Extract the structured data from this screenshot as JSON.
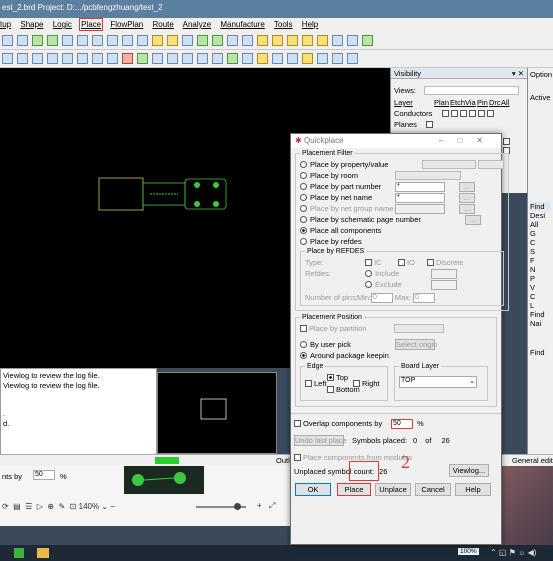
{
  "title": "est_2.brd  Project: D:.../pcbfengzhuang/test_2",
  "menu": [
    "tup",
    "Shape",
    "Logic",
    "Place",
    "FlowPlan",
    "Route",
    "Analyze",
    "Manufacture",
    "Tools",
    "Help"
  ],
  "visibility": {
    "title": "Visibility",
    "views_label": "Views:",
    "cols": [
      "Layer",
      "Plan",
      "Etch",
      "Via",
      "Pin",
      "Drc",
      "All"
    ],
    "rows": [
      "Conductors",
      "Planes"
    ]
  },
  "right_labels": [
    "Option",
    "Active",
    "Find",
    "Desi",
    "All",
    "G",
    "C",
    "S",
    "F",
    "N",
    "P",
    "V",
    "C",
    "L",
    "Find",
    "Nai",
    "Find"
  ],
  "log": [
    "Viewlog to review the log file.",
    "Viewlog to review the log file.",
    "",
    ".",
    "d."
  ],
  "status": {
    "outline": "Outlin",
    "edit": "General edit"
  },
  "strip": {
    "label": "nts by",
    "value": "50",
    "pct": "%",
    "zoom": "140%"
  },
  "dialog": {
    "title": "Quickplace",
    "filter_legend": "Placement Filter",
    "options": [
      "Place by property/value",
      "Place by room",
      "Place by part number",
      "Place by net name",
      "Place by net group name",
      "Place by schematic page number",
      "Place all components",
      "Place by refdes"
    ],
    "selected_option": "Place all components",
    "refdes_legend": "Place by REFDES",
    "type_label": "Type:",
    "type_ic": "IC",
    "type_io": "IO",
    "type_discrete": "Discrete",
    "refdes_label": "Refdes:",
    "include": "Include",
    "exclude": "Exclude",
    "pins_label": "Number of pins:",
    "min_label": "Min:",
    "min_value": "0",
    "max_label": "Max:",
    "max_value": "0",
    "pos_legend": "Placement Position",
    "by_partition": "Place by partition",
    "by_user_pick": "By user pick",
    "select_origin": "Select origin",
    "around_keepin": "Around package keepin",
    "edge_legend": "Edge",
    "left": "Left",
    "top": "Top",
    "right": "Right",
    "bottom": "Bottom",
    "board_layer_legend": "Board Layer",
    "board_layer_value": "TOP",
    "overlap_label": "Overlap components by",
    "overlap_value": "50",
    "overlap_pct": "%",
    "undo_last": "Undo last place",
    "symbols_placed_label": "Symbols placed:",
    "symbols_placed": "0",
    "of_label": "of",
    "symbols_total": "26",
    "from_modules": "Place components from modules",
    "unplaced_label": "Unplaced symbol count:",
    "unplaced_value": "26",
    "viewlog": "Viewlog...",
    "ok": "OK",
    "place": "Place",
    "unplace": "Unplace",
    "cancel": "Cancel",
    "help": "Help",
    "annotation_two": "2"
  },
  "taskbar_badge": "100%",
  "colors": {
    "accent_red": "#e23535",
    "canvas": "#000000",
    "part_outline": "#c8c84a"
  }
}
